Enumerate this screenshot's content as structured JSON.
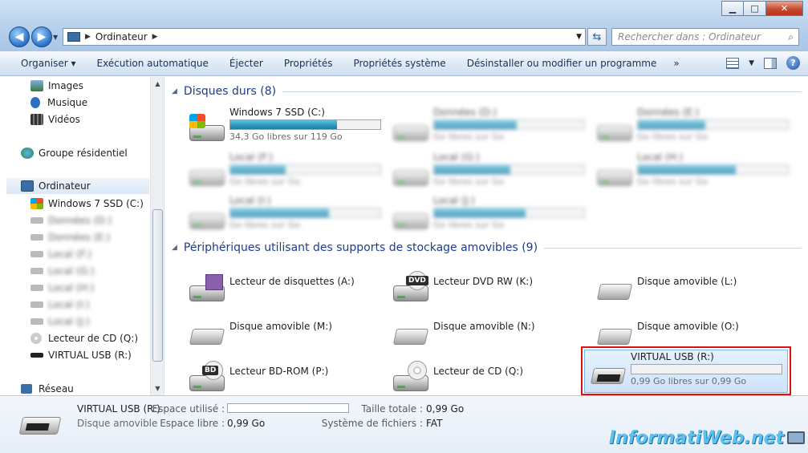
{
  "window": {
    "controls": {
      "minimize": "▁",
      "maximize": "□",
      "close": "✕"
    }
  },
  "address_bar": {
    "breadcrumb": "Ordinateur",
    "search_placeholder": "Rechercher dans : Ordinateur"
  },
  "toolbar": {
    "items": [
      "Organiser ▾",
      "Exécution automatique",
      "Éjecter",
      "Propriétés",
      "Propriétés système",
      "Désinstaller ou modifier un programme"
    ],
    "more": "»"
  },
  "sidebar": {
    "libraries": [
      "Images",
      "Musique",
      "Vidéos"
    ],
    "homegroup": "Groupe résidentiel",
    "computer": "Ordinateur",
    "drives_visible": [
      "Windows 7 SSD (C:)"
    ],
    "drives_hidden": [
      "Données (D:)",
      "Données (E:)",
      "Local (F:)",
      "Local (G:)",
      "Local (H:)",
      "Local (I:)",
      "Local (J:)"
    ],
    "drives_after": [
      "Lecteur de CD (Q:)",
      "VIRTUAL USB (R:)"
    ],
    "network": "Réseau"
  },
  "content": {
    "hard_drives_header": "Disques durs (8)",
    "hard_drives": [
      {
        "name": "Windows 7 SSD (C:)",
        "free": "34,3 Go libres sur 119 Go",
        "used_fraction": 0.71,
        "blurred": false
      },
      {
        "name": "Données (D:)",
        "free": "Go libres sur Go",
        "used_fraction": 0.55,
        "blurred": true
      },
      {
        "name": "Données (E:)",
        "free": "Go libres sur Go",
        "used_fraction": 0.45,
        "blurred": true
      },
      {
        "name": "Local (F:)",
        "free": "Go libres sur Go",
        "used_fraction": 0.37,
        "blurred": true
      },
      {
        "name": "Local (G:)",
        "free": "Go libres sur Go",
        "used_fraction": 0.51,
        "blurred": true
      },
      {
        "name": "Local (H:)",
        "free": "Go libres sur Go",
        "used_fraction": 0.65,
        "blurred": true
      },
      {
        "name": "Local (I:)",
        "free": "Go libres sur Go",
        "used_fraction": 0.66,
        "blurred": true
      },
      {
        "name": "Local (J:)",
        "free": "Go libres sur Go",
        "used_fraction": 0.61,
        "blurred": true
      }
    ],
    "removable_header": "Périphériques utilisant des supports de stockage amovibles (9)",
    "removable": [
      {
        "name": "Lecteur de disquettes (A:)",
        "icon": "floppy-drive-icon"
      },
      {
        "name": "Lecteur DVD RW (K:)",
        "icon": "dvd-drive-icon",
        "badge": "DVD"
      },
      {
        "name": "Disque amovible (L:)",
        "icon": "removable-disk-icon"
      },
      {
        "name": "Disque amovible (M:)",
        "icon": "removable-disk-icon"
      },
      {
        "name": "Disque amovible (N:)",
        "icon": "removable-disk-icon"
      },
      {
        "name": "Disque amovible (O:)",
        "icon": "removable-disk-icon"
      },
      {
        "name": "Lecteur BD-ROM (P:)",
        "icon": "bd-drive-icon",
        "badge": "BD"
      },
      {
        "name": "Lecteur de CD (Q:)",
        "icon": "cd-drive-icon"
      }
    ],
    "selected_drive": {
      "name": "VIRTUAL USB (R:)",
      "free": "0,99 Go libres sur 0,99 Go",
      "used_fraction": 0.0
    }
  },
  "details": {
    "name": "VIRTUAL USB (R:)",
    "type": "Disque amovible",
    "used_label": "Espace utilisé :",
    "free_label": "Espace libre :",
    "free_value": "0,99 Go",
    "total_label": "Taille totale :",
    "total_value": "0,99 Go",
    "fs_label": "Système de fichiers :",
    "fs_value": "FAT"
  },
  "watermark": "InformatiWeb.net",
  "colors": {
    "accent": "#1e3c8c",
    "progress": "#2d98c0",
    "selection_outline": "#e01010"
  }
}
